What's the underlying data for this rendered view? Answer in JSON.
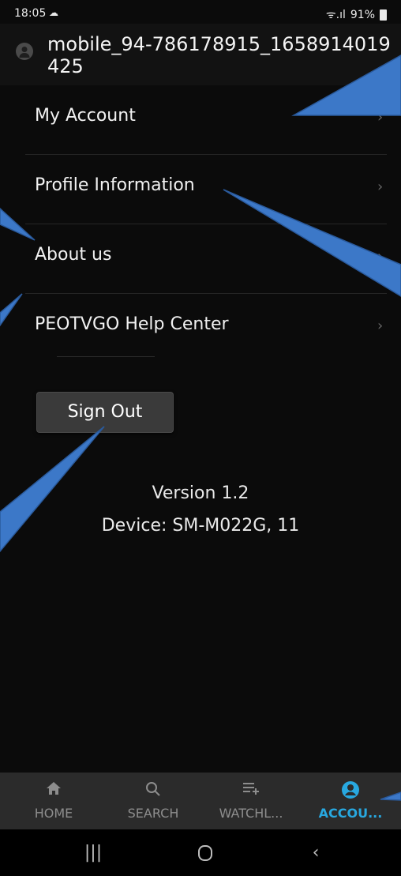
{
  "status_bar": {
    "time": "18:05",
    "signal_text": "ᯤ.ıl",
    "battery": "91%"
  },
  "header": {
    "username": "mobile_94-786178915_1658914019425"
  },
  "menu": {
    "items": [
      {
        "label": "My Account"
      },
      {
        "label": "Profile Information"
      },
      {
        "label": "About us"
      },
      {
        "label": "PEOTVGO Help Center"
      }
    ],
    "chevron": "›"
  },
  "sign_out_label": "Sign Out",
  "version_text": "Version 1.2",
  "device_text": "Device: SM-M022G, 11",
  "bottom_nav": {
    "tabs": [
      {
        "label": "HOME",
        "icon": "home-icon"
      },
      {
        "label": "SEARCH",
        "icon": "search-icon"
      },
      {
        "label": "WATCHL...",
        "icon": "watchlist-add-icon"
      },
      {
        "label": "ACCOU...",
        "icon": "account-icon",
        "active": true
      }
    ]
  },
  "system_nav": {
    "recents": "|||",
    "back": "‹"
  },
  "colors": {
    "accent": "#28a8e0",
    "annotation": "#3c78c8"
  }
}
